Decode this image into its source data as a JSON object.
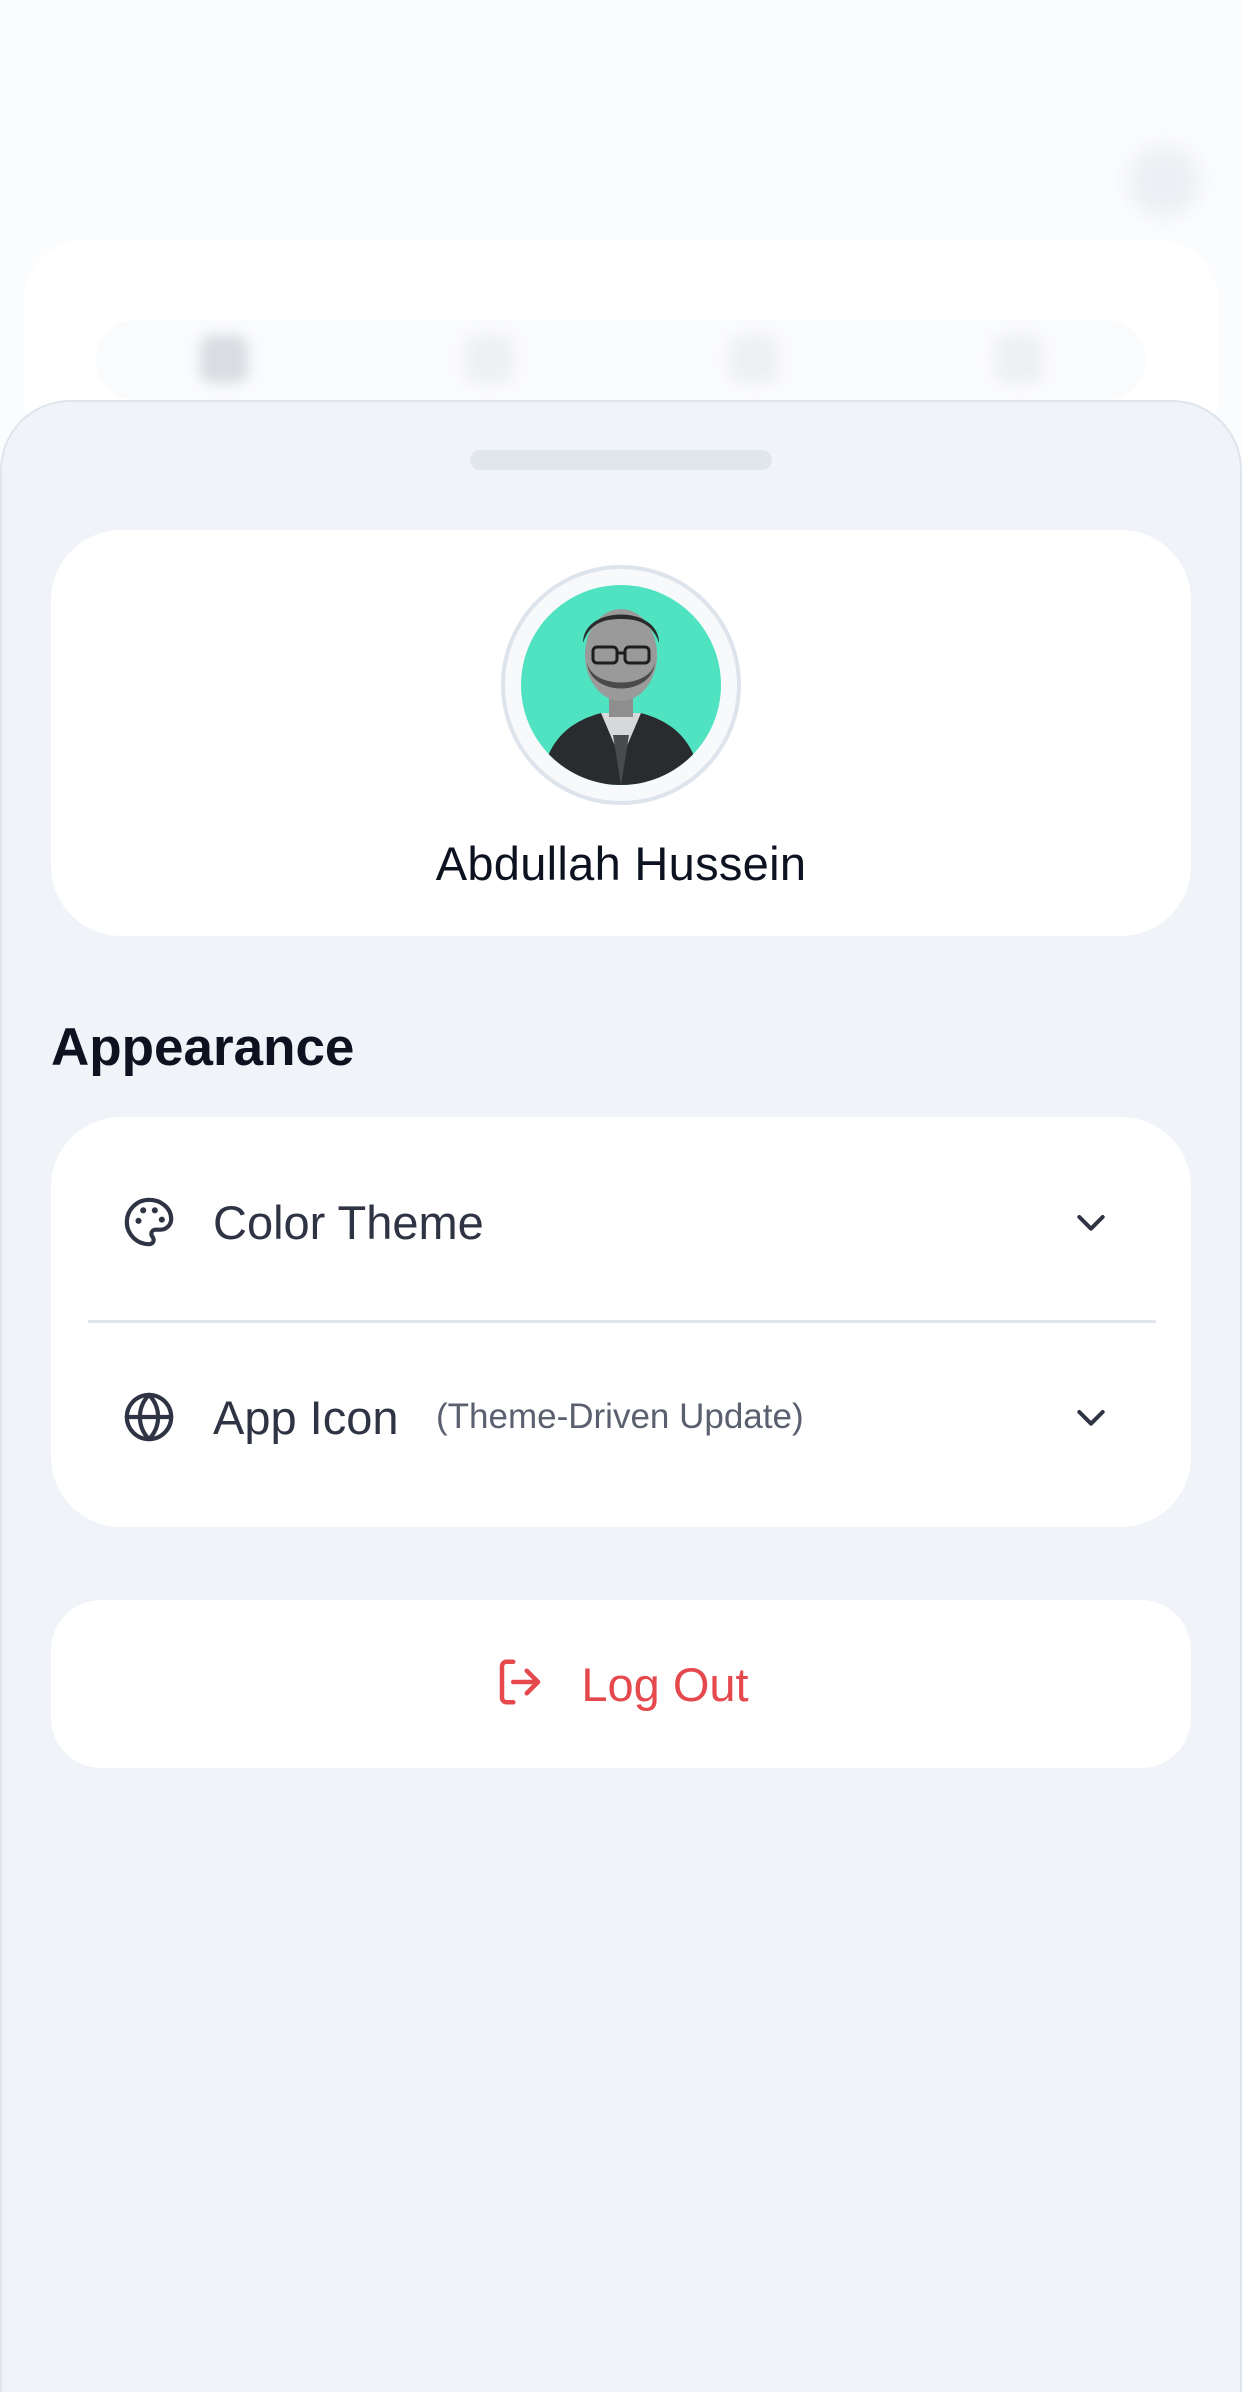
{
  "profile": {
    "name": "Abdullah Hussein"
  },
  "appearance": {
    "section_title": "Appearance",
    "rows": [
      {
        "icon": "palette-icon",
        "label": "Color Theme",
        "sublabel": ""
      },
      {
        "icon": "globe-icon",
        "label": "App Icon",
        "sublabel": "(Theme-Driven Update)"
      }
    ]
  },
  "logout": {
    "label": "Log Out",
    "icon": "logout-icon",
    "color": "#e5484d"
  },
  "colors": {
    "sheet_bg": "#f0f3f7",
    "card_bg": "#ffffff",
    "avatar_bg": "#4fe3c1",
    "text_primary": "#0d1220"
  }
}
